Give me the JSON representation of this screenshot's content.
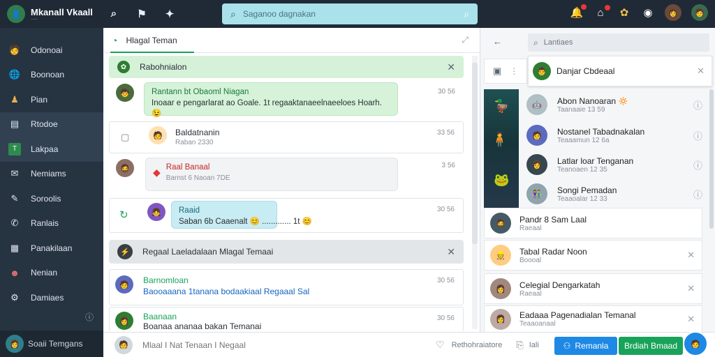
{
  "app": {
    "title": "Mkanall Vkaall",
    "subtitle": "....."
  },
  "search": {
    "placeholder": "Saganoo dagnakan"
  },
  "sidebar": {
    "items": [
      {
        "label": "Odonoai"
      },
      {
        "label": "Boonoan"
      },
      {
        "label": "Pian"
      },
      {
        "label": "Rtodoe"
      },
      {
        "label": "Lakpaa"
      },
      {
        "label": "Nemiams"
      },
      {
        "label": "Soroolis"
      },
      {
        "label": "Ranlais"
      },
      {
        "label": "Panakilaan"
      },
      {
        "label": "Nenian"
      },
      {
        "label": "Damiaes"
      }
    ],
    "footer": "Soaii Temgans"
  },
  "main": {
    "tab_label": "Hlagal Teman",
    "banner_top": "Rabohnialon",
    "threads": [
      {
        "title": "Rantann bt Obaoml Niagan",
        "text": "Inoaar e pengarlarat ao Goale. 1t regaaktanaeelnaeeloes Hoarh. 😉",
        "time": "30 56"
      },
      {
        "title": "Baldatnanin",
        "sub": "Raban 2330",
        "time": "33 56"
      },
      {
        "title": "Raal Banaal",
        "text": "Barnst 6 Naoan 7DE",
        "time": "3 56"
      },
      {
        "title": "Raaid",
        "text": "Saban 6b Caaenalt 😊 ............. 1t 😊",
        "time": "30 56"
      }
    ],
    "banner_mid": "Regaal Laeladalaan Mlagal Temaai",
    "threads2": [
      {
        "title": "Barnomloan",
        "text": "Baooaaana 1tanana bodaakiaal Regaaal Sal",
        "time": "30 56"
      },
      {
        "title": "Baanaan",
        "text": "Boanaa ananaa bakan Temanai",
        "time": "30 56"
      }
    ]
  },
  "composer": {
    "placeholder": "Mlaal I Nat Tenaan I Negaal",
    "emoji_label": "Rethohraiatore",
    "attach_label": "Iali",
    "btn_primary": "Remanla",
    "btn_send": "Brdiah Bmaad"
  },
  "right": {
    "search_placeholder": "Lantiaes",
    "contacts": [
      {
        "name": "Danjar Cbdeaal"
      },
      {
        "name": "Abon Nanoaran 🔅",
        "sub": "Taanaaie 13 59"
      },
      {
        "name": "Nostanel Tabadnakalan",
        "sub": "Teaaamun 12 6a"
      },
      {
        "name": "Latlar loar Tenganan",
        "sub": "Teanoaen 12 35"
      },
      {
        "name": "Songi Pemadan",
        "sub": "Teaaoalar 12 33"
      },
      {
        "name": "Pandr 8 Sam Laal",
        "sub": "Raeaal"
      },
      {
        "name": "Tabal Radar Noon",
        "sub": "Boooal"
      },
      {
        "name": "Celegial Dengarkatah",
        "sub": "Raeaal"
      },
      {
        "name": "Eadaaa Pagenadialan Temanal",
        "sub": "Teaaoanaal"
      }
    ]
  },
  "colors": {
    "topbar": "#1f2a36",
    "sidebar": "#263341",
    "accent_green": "#19a35a",
    "search": "#a9e2ea",
    "send_blue": "#1e88e5"
  }
}
